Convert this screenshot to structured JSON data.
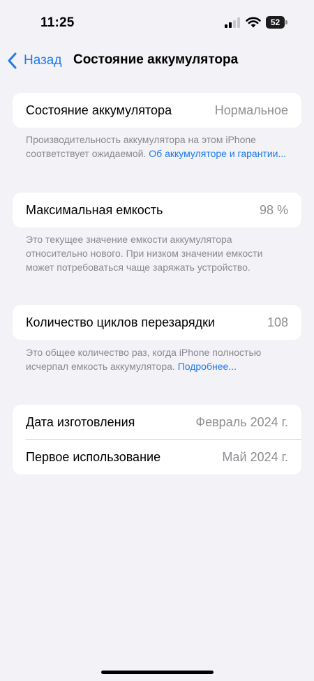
{
  "status_bar": {
    "time": "11:25",
    "battery_level": "52",
    "signal_icon": "cellular-signal-icon",
    "wifi_icon": "wifi-icon",
    "battery_icon": "battery-icon"
  },
  "nav": {
    "back_label": "Назад",
    "back_icon": "chevron-left-icon",
    "title": "Состояние аккумулятора"
  },
  "sections": {
    "health": {
      "label": "Состояние аккумулятора",
      "value": "Нормальное",
      "footer_text": "Производительность аккумулятора на этом iPhone соответствует ожидаемой. ",
      "footer_link": "Об аккумуляторе и гарантии..."
    },
    "capacity": {
      "label": "Максимальная емкость",
      "value": "98 %",
      "footer_text": "Это текущее значение емкости аккумулятора относительно нового. При низком значении емкости может потребоваться чаще заряжать устройство."
    },
    "cycles": {
      "label": "Количество циклов перезарядки",
      "value": "108",
      "footer_text": "Это общее количество раз, когда iPhone полностью исчерпал емкость аккумулятора. ",
      "footer_link": "Подробнее..."
    },
    "dates": {
      "manufacture_label": "Дата изготовления",
      "manufacture_value": "Февраль 2024 г.",
      "first_use_label": "Первое использование",
      "first_use_value": "Май 2024 г."
    }
  },
  "colors": {
    "background": "#f2f2f7",
    "accent": "#1e7bf0",
    "secondary_text": "#8e8e93"
  }
}
